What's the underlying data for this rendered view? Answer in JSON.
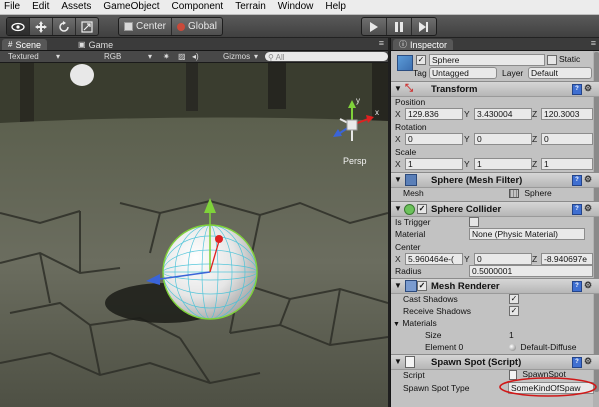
{
  "menu": [
    "File",
    "Edit",
    "Assets",
    "GameObject",
    "Component",
    "Terrain",
    "Window",
    "Help"
  ],
  "toolbar": {
    "pivot": "Center",
    "space": "Global",
    "play_icon": "play-icon",
    "pause_icon": "pause-icon",
    "step_icon": "step-icon"
  },
  "scene": {
    "tab_scene": "Scene",
    "tab_game": "Game",
    "render_mode": "Textured",
    "color_mode": "RGB",
    "gizmos": "Gizmos",
    "search_placeholder": "All",
    "persp_label": "Persp",
    "axis_y": "y",
    "axis_x": "x"
  },
  "inspector": {
    "tab": "Inspector",
    "object_name": "Sphere",
    "static_label": "Static",
    "tag_label": "Tag",
    "tag_value": "Untagged",
    "layer_label": "Layer",
    "layer_value": "Default",
    "transform": {
      "title": "Transform",
      "position_label": "Position",
      "position": {
        "x": "129.836",
        "y": "3.430004",
        "z": "120.3003"
      },
      "rotation_label": "Rotation",
      "rotation": {
        "x": "0",
        "y": "0",
        "z": "0"
      },
      "scale_label": "Scale",
      "scale": {
        "x": "1",
        "y": "1",
        "z": "1"
      }
    },
    "mesh_filter": {
      "title": "Sphere (Mesh Filter)",
      "mesh_label": "Mesh",
      "mesh_value": "Sphere"
    },
    "sphere_collider": {
      "title": "Sphere Collider",
      "is_trigger_label": "Is Trigger",
      "material_label": "Material",
      "material_value": "None (Physic Material)",
      "center_label": "Center",
      "center": {
        "x": "5.960464e-(",
        "y": "0",
        "z": "-8.940697e"
      },
      "radius_label": "Radius",
      "radius_value": "0.5000001"
    },
    "mesh_renderer": {
      "title": "Mesh Renderer",
      "cast_shadows_label": "Cast Shadows",
      "receive_shadows_label": "Receive Shadows",
      "materials_label": "Materials",
      "size_label": "Size",
      "size_value": "1",
      "element0_label": "Element 0",
      "element0_value": "Default-Diffuse"
    },
    "spawn_spot": {
      "title": "Spawn Spot (Script)",
      "script_label": "Script",
      "script_value": "SpawnSpot",
      "type_label": "Spawn Spot Type",
      "type_value": "SomeKindOfSpaw"
    }
  },
  "colors": {
    "highlight_ellipse": "#d01818",
    "gizmo_green": "#7fd23a",
    "gizmo_red": "#e02020",
    "gizmo_blue": "#3a64d8"
  }
}
